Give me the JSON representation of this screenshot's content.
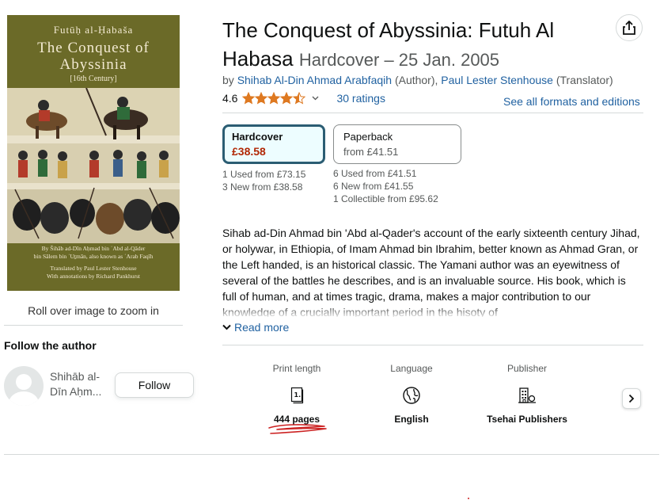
{
  "cover": {
    "title_line1": "Futūḥ al-Ḥabaša",
    "title_line2": "The Conquest of Abyssinia",
    "title_line3": "[16th Century]",
    "footer_line1": "By Šihāb ad-Dīn Aḥmad bin ʿAbd al-Qāder",
    "footer_line2": "bin Sālem bin ʿUṯmān, also known as ʿArab Faqīh",
    "footer_line3": "Translated by Paul Lester Stenhouse",
    "footer_line4": "With annotations by Richard Pankhurst",
    "background_color": "#6b6a28"
  },
  "gallery": {
    "zoom_hint": "Roll over image to zoom in"
  },
  "author_panel": {
    "heading": "Follow the author",
    "author_name": "Shihāb al-Dīn Aḥm...",
    "follow_label": "Follow",
    "avatar_icon": "person-silhouette-icon"
  },
  "product": {
    "title": "The Conquest of Abyssinia: Futuh Al Habasa",
    "format_date": "Hardcover – 25 Jan. 2005",
    "by_prefix": "by",
    "author1": "Shihab Al-Din Ahmad Arabfaqih",
    "author1_role": "(Author)",
    "separator": ",",
    "author2": "Paul Lester Stenhouse",
    "author2_role": "(Translator)",
    "rating_value": "4.6",
    "stars_out_of_5": 4.5,
    "rating_count": "30 ratings",
    "see_formats": "See all formats and editions",
    "share_icon": "share-icon"
  },
  "formats": {
    "hardcover": {
      "name": "Hardcover",
      "price": "£38.58",
      "offers": [
        "1 Used from £73.15",
        "3 New from £38.58"
      ]
    },
    "paperback": {
      "name": "Paperback",
      "price": "from £41.51",
      "offers": [
        "6 Used from £41.51",
        "6 New from £41.55",
        "1 Collectible from £95.62"
      ]
    }
  },
  "description": {
    "text": "Sihab ad-Din Ahmad bin 'Abd al-Qader's account of the early sixteenth century Jihad, or holywar, in Ethiopia, of Imam Ahmad bin Ibrahim, better known as Ahmad Gran, or the Left handed, is an historical classic. The Yamani author was an eyewitness of several of the battles he describes, and is an invaluable source. His book, which is full of human, and at times tragic, drama, makes a major contribution to our knowledge of a crucially important period in the hisoty of",
    "read_more": "Read more"
  },
  "attributes": [
    {
      "label": "Print length",
      "value": "444 pages",
      "icon": "book-pages-icon"
    },
    {
      "label": "Language",
      "value": "English",
      "icon": "globe-icon"
    },
    {
      "label": "Publisher",
      "value": "Tsehai Publishers",
      "icon": "building-icon"
    }
  ],
  "colors": {
    "link": "#2162a1",
    "price": "#b12704",
    "selected_border": "#2b5d73",
    "star": "#de7921",
    "annotation": "#cc2222"
  }
}
